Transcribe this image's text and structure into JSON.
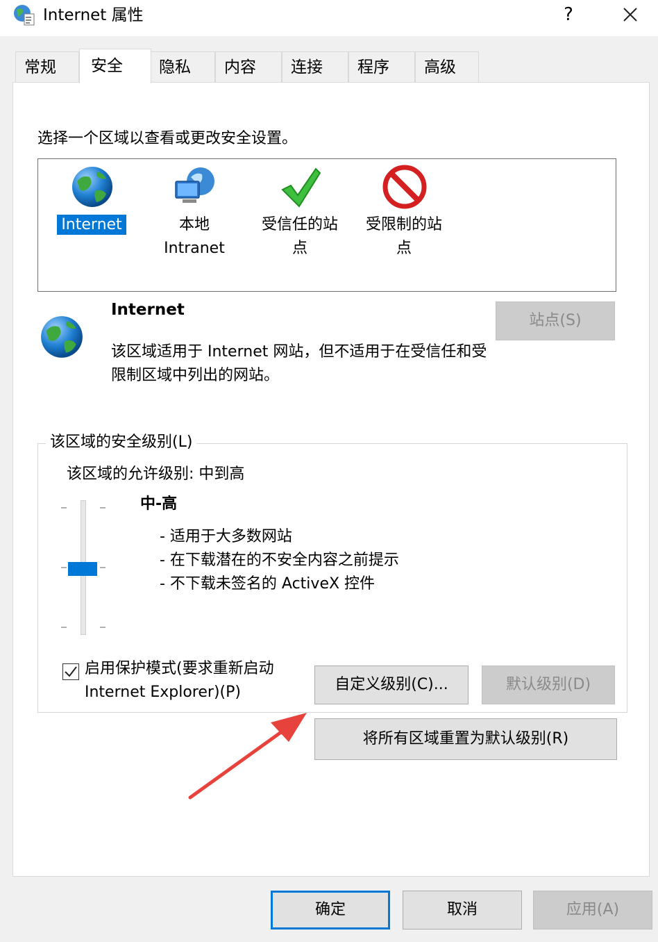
{
  "window": {
    "title": "Internet 属性",
    "help": "?"
  },
  "tabs": [
    {
      "label": "常规"
    },
    {
      "label": "安全",
      "active": true
    },
    {
      "label": "隐私"
    },
    {
      "label": "内容"
    },
    {
      "label": "连接"
    },
    {
      "label": "程序"
    },
    {
      "label": "高级"
    }
  ],
  "zone_prompt": "选择一个区域以查看或更改安全设置。",
  "zones": [
    {
      "label_lines": [
        "Internet"
      ],
      "icon": "globe-icon",
      "selected": true
    },
    {
      "label_lines": [
        "本地",
        "Intranet"
      ],
      "icon": "intranet-icon"
    },
    {
      "label_lines": [
        "受信任的站",
        "点"
      ],
      "icon": "checkmark-icon"
    },
    {
      "label_lines": [
        "受限制的站",
        "点"
      ],
      "icon": "prohibited-icon"
    }
  ],
  "selected_zone": {
    "name": "Internet",
    "description": "该区域适用于 Internet 网站，但不适用于在受信任和受限制区域中列出的网站。",
    "sites_button": "站点(S)"
  },
  "security_level": {
    "group_label": "该区域的安全级别(L)",
    "allowed_level": "该区域的允许级别: 中到高",
    "level_name": "中-高",
    "slider_position": 0.5,
    "bullets": [
      "- 适用于大多数网站",
      "- 在下载潜在的不安全内容之前提示",
      "- 不下载未签名的 ActiveX 控件"
    ],
    "protected_mode": {
      "checked": true,
      "label": "启用保护模式(要求重新启动 Internet Explorer)(P)"
    },
    "custom_button": "自定义级别(C)...",
    "default_button": "默认级别(D)"
  },
  "reset_button": "将所有区域重置为默认级别(R)",
  "footer": {
    "ok": "确定",
    "cancel": "取消",
    "apply": "应用(A)"
  },
  "colors": {
    "accent": "#0078d7",
    "arrow": "#e8423c"
  }
}
